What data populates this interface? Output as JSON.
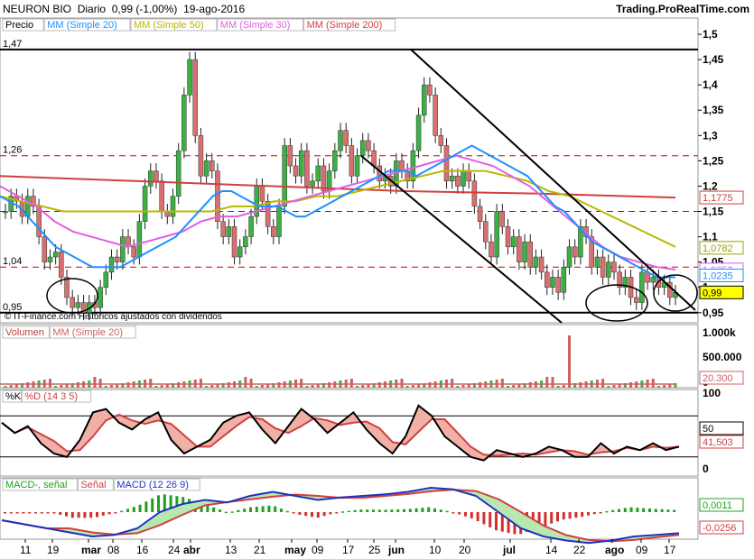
{
  "header": {
    "ticker": "NEURON BIO",
    "period": "Diario",
    "last": "0,99 (-1,00%)",
    "date": "19-ago-2016",
    "source": "Trading.ProRealTime.com"
  },
  "price_panel": {
    "legend": [
      "Precio",
      "MM (Simple 20)",
      "MM (Simple 50)",
      "MM (Simple 30)",
      "MM (Simple 200)"
    ],
    "legend_colors": [
      "#000000",
      "#1e90ff",
      "#b8b800",
      "#e060e0",
      "#d04040"
    ],
    "note": "© IT-Finance.com Históricos ajustados con dividendos",
    "left_levels": [
      "1,47",
      "1,26",
      "1,04",
      "0,95"
    ],
    "axis_ticks": [
      "1,5",
      "1,45",
      "1,4",
      "1,35",
      "1,3",
      "1,25",
      "1,2",
      "1,15",
      "1,1",
      "1,05",
      "1",
      "0,95"
    ],
    "tags": [
      {
        "text": "1,1775",
        "value": 1.1775,
        "color": "#d04040",
        "bg": "#ffffff"
      },
      {
        "text": "1,0782",
        "value": 1.0782,
        "color": "#a0a000",
        "bg": "#ffffff"
      },
      {
        "text": "1,0353",
        "value": 1.0353,
        "color": "#e060e0",
        "bg": "#ffffff"
      },
      {
        "text": "1,0235",
        "value": 1.0235,
        "color": "#1e90ff",
        "bg": "#ffffff"
      },
      {
        "text": "0,99",
        "value": 0.99,
        "color": "#000000",
        "bg": "#ffff00"
      }
    ]
  },
  "volume_panel": {
    "legend": [
      "Volumen",
      "MM (Simple 20)"
    ],
    "axis_ticks": [
      "1.000k",
      "500.000",
      "0"
    ],
    "tag": "20.300"
  },
  "stoch_panel": {
    "legend": [
      "%K",
      "%D (14 3 5)"
    ],
    "axis_ticks": [
      "100",
      "50",
      "0"
    ],
    "tags": [
      "50",
      "41,503"
    ]
  },
  "macd_panel": {
    "legend": [
      "MACD-, señal",
      "Señal",
      "MACD (12 26 9)"
    ],
    "tags": [
      "0,0011",
      "-0,0256"
    ]
  },
  "x_axis": [
    "11",
    "19",
    "mar",
    "08",
    "16",
    "24",
    "abr",
    "13",
    "21",
    "may",
    "09",
    "17",
    "25",
    "jun",
    "10",
    "20",
    "jul",
    "14",
    "22",
    "ago",
    "09",
    "17"
  ],
  "chart_data": {
    "type": "candlestick",
    "ylim": [
      0.93,
      1.5
    ],
    "close": [
      1.15,
      1.18,
      1.17,
      1.14,
      1.18,
      1.16,
      1.1,
      1.05,
      1.06,
      1.07,
      1.02,
      0.98,
      0.96,
      0.97,
      0.95,
      0.97,
      0.96,
      1.0,
      1.03,
      1.06,
      1.05,
      1.1,
      1.08,
      1.06,
      1.13,
      1.2,
      1.23,
      1.21,
      1.15,
      1.14,
      1.18,
      1.27,
      1.38,
      1.45,
      1.3,
      1.22,
      1.25,
      1.23,
      1.13,
      1.1,
      1.12,
      1.06,
      1.08,
      1.1,
      1.14,
      1.2,
      1.17,
      1.12,
      1.1,
      1.16,
      1.28,
      1.24,
      1.22,
      1.27,
      1.2,
      1.21,
      1.24,
      1.19,
      1.23,
      1.27,
      1.31,
      1.28,
      1.22,
      1.26,
      1.29,
      1.27,
      1.24,
      1.21,
      1.22,
      1.2,
      1.25,
      1.23,
      1.21,
      1.27,
      1.34,
      1.4,
      1.38,
      1.3,
      1.28,
      1.21,
      1.22,
      1.2,
      1.23,
      1.21,
      1.16,
      1.13,
      1.09,
      1.06,
      1.15,
      1.12,
      1.08,
      1.1,
      1.05,
      1.09,
      1.04,
      1.06,
      1.03,
      1.0,
      1.02,
      0.99,
      1.04,
      1.08,
      1.06,
      1.12,
      1.1,
      1.04,
      1.06,
      1.02,
      1.05,
      1.03,
      1.0,
      1.02,
      0.98,
      0.97,
      1.03,
      1.01,
      1.02,
      1.0,
      1.01,
      0.98,
      0.99
    ],
    "ma20": [
      1.18,
      1.17,
      1.16,
      1.14,
      1.12,
      1.1,
      1.08,
      1.07,
      1.06,
      1.05,
      1.04,
      1.04,
      1.04,
      1.04,
      1.05,
      1.06,
      1.07,
      1.08,
      1.09,
      1.1,
      1.12,
      1.14,
      1.16,
      1.18,
      1.19,
      1.19,
      1.18,
      1.17,
      1.16,
      1.16,
      1.16,
      1.15,
      1.14,
      1.14,
      1.15,
      1.16,
      1.17,
      1.18,
      1.19,
      1.2,
      1.21,
      1.22,
      1.23,
      1.23,
      1.23,
      1.22,
      1.23,
      1.24,
      1.25,
      1.26,
      1.27,
      1.28,
      1.27,
      1.26,
      1.25,
      1.24,
      1.23,
      1.22,
      1.2,
      1.18,
      1.16,
      1.15,
      1.13,
      1.11,
      1.09,
      1.08,
      1.07,
      1.06,
      1.05,
      1.04,
      1.03,
      1.02,
      1.02,
      1.02
    ],
    "ma50": [
      1.18,
      1.17,
      1.16,
      1.15,
      1.15,
      1.15,
      1.15,
      1.15,
      1.15,
      1.15,
      1.15,
      1.16,
      1.16,
      1.17,
      1.17,
      1.18,
      1.18,
      1.19,
      1.2,
      1.21,
      1.22,
      1.23,
      1.23,
      1.23,
      1.22,
      1.21,
      1.19,
      1.18,
      1.16,
      1.14,
      1.12,
      1.1,
      1.08
    ],
    "ma30": [
      1.2,
      1.18,
      1.16,
      1.13,
      1.11,
      1.1,
      1.09,
      1.08,
      1.09,
      1.1,
      1.11,
      1.13,
      1.14,
      1.14,
      1.15,
      1.16,
      1.17,
      1.18,
      1.19,
      1.2,
      1.21,
      1.22,
      1.23,
      1.24,
      1.25,
      1.26,
      1.25,
      1.24,
      1.22,
      1.2,
      1.17,
      1.14,
      1.11,
      1.08,
      1.06,
      1.05,
      1.04,
      1.035
    ],
    "ma200": [
      1.22,
      1.21,
      1.2,
      1.19,
      1.185,
      1.1775
    ],
    "stoch_k": [
      70,
      55,
      65,
      40,
      25,
      20,
      45,
      85,
      90,
      70,
      60,
      75,
      85,
      45,
      25,
      35,
      45,
      70,
      80,
      85,
      60,
      40,
      65,
      90,
      75,
      55,
      70,
      85,
      60,
      40,
      25,
      50,
      95,
      80,
      50,
      35,
      20,
      15,
      30,
      25,
      20,
      25,
      35,
      30,
      20,
      20,
      40,
      25,
      35,
      30,
      40,
      30,
      35
    ],
    "macd": [
      -0.01,
      -0.015,
      -0.02,
      -0.025,
      -0.03,
      -0.028,
      -0.02,
      0.0,
      0.01,
      0.015,
      0.012,
      0.02,
      0.025,
      0.02,
      0.015,
      0.018,
      0.02,
      0.022,
      0.025,
      0.03,
      0.028,
      0.02,
      0.0,
      -0.02,
      -0.03,
      -0.035,
      -0.038,
      -0.035,
      -0.03,
      -0.028,
      -0.026
    ]
  }
}
